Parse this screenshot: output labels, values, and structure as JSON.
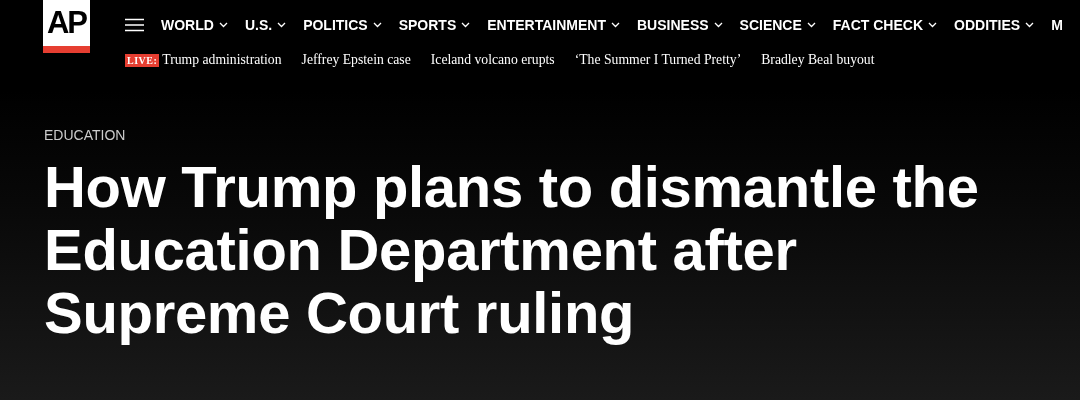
{
  "logo": {
    "text": "AP"
  },
  "nav": {
    "items": [
      {
        "label": "WORLD",
        "dropdown": true
      },
      {
        "label": "U.S.",
        "dropdown": true
      },
      {
        "label": "POLITICS",
        "dropdown": true
      },
      {
        "label": "SPORTS",
        "dropdown": true
      },
      {
        "label": "ENTERTAINMENT",
        "dropdown": true
      },
      {
        "label": "BUSINESS",
        "dropdown": true
      },
      {
        "label": "SCIENCE",
        "dropdown": true
      },
      {
        "label": "FACT CHECK",
        "dropdown": true
      },
      {
        "label": "ODDITIES",
        "dropdown": true
      },
      {
        "label": "M",
        "dropdown": false
      }
    ]
  },
  "trending": {
    "live_badge": "LIVE:",
    "items": [
      "Trump administration",
      "Jeffrey Epstein case",
      "Iceland volcano erupts",
      "‘The Summer I Turned Pretty’",
      "Bradley Beal buyout"
    ]
  },
  "article": {
    "section": "EDUCATION",
    "headline": "How Trump plans to dismantle the Education Department after Supreme Court ruling"
  }
}
